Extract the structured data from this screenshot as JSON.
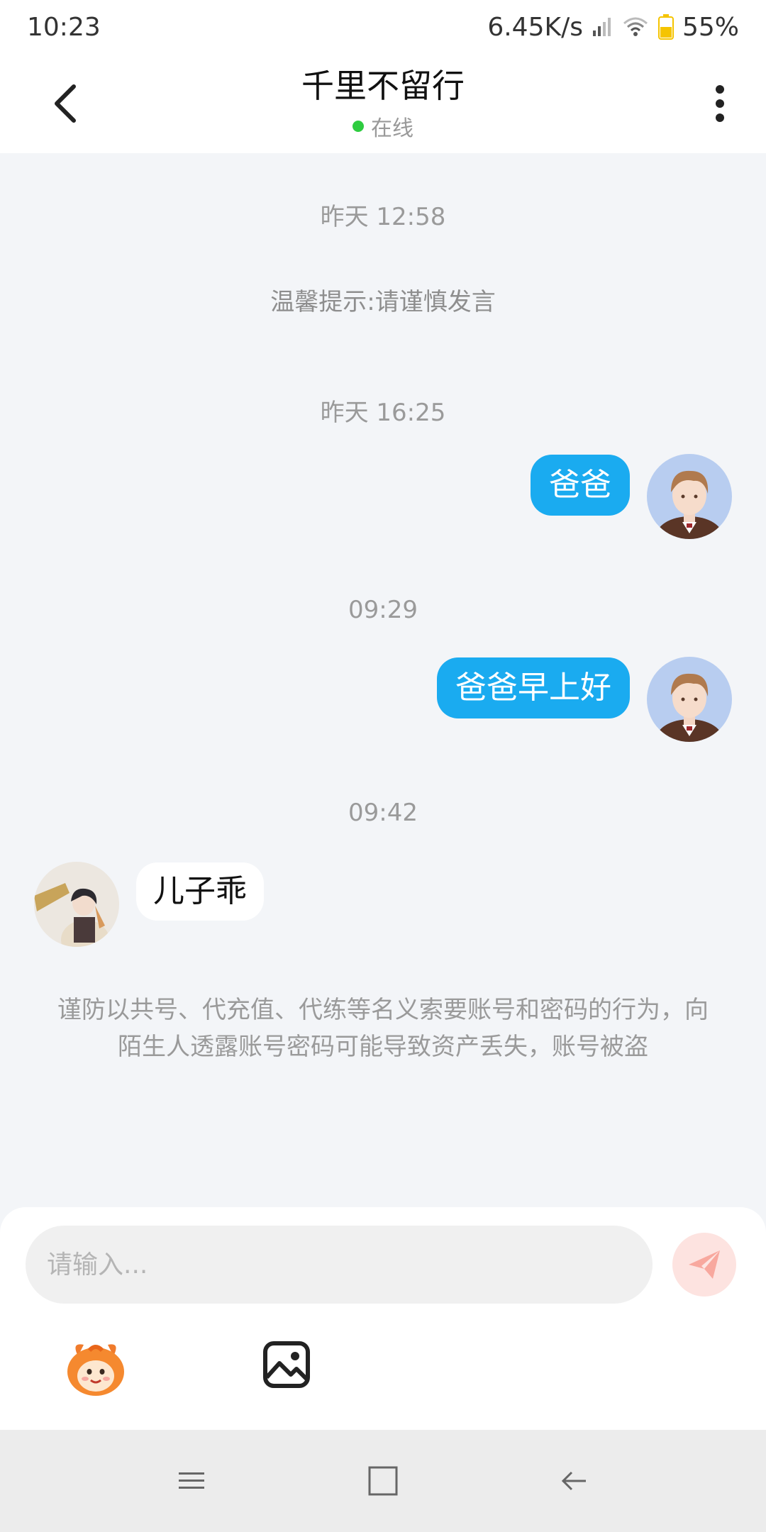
{
  "status_bar": {
    "time": "10:23",
    "network_speed": "6.45K/s",
    "battery": "55%"
  },
  "header": {
    "title": "千里不留行",
    "status": "在线",
    "back_icon": "chevron-left-icon",
    "more_icon": "more-vertical-icon"
  },
  "chat": {
    "timestamps": [
      "昨天 12:58",
      "昨天 16:25",
      "09:29",
      "09:42"
    ],
    "tip": "温馨提示:请谨慎发言",
    "messages": [
      {
        "direction": "out",
        "text": "爸爸"
      },
      {
        "direction": "out",
        "text": "爸爸早上好"
      },
      {
        "direction": "in",
        "text": "儿子乖"
      }
    ],
    "warning": "谨防以共号、代充值、代练等名义索要账号和密码的行为，向陌生人透露账号密码可能导致资产丢失，账号被盗"
  },
  "input": {
    "placeholder": "请输入...",
    "send_icon": "send-icon",
    "emoji_icon": "mascot-emoji-icon",
    "image_icon": "image-icon"
  },
  "nav": {
    "menu_icon": "menu-icon",
    "home_icon": "square-home-icon",
    "back_icon": "back-arrow-icon"
  },
  "colors": {
    "accent": "#1aabf0",
    "online": "#2ecc40",
    "background": "#f3f5f8"
  }
}
